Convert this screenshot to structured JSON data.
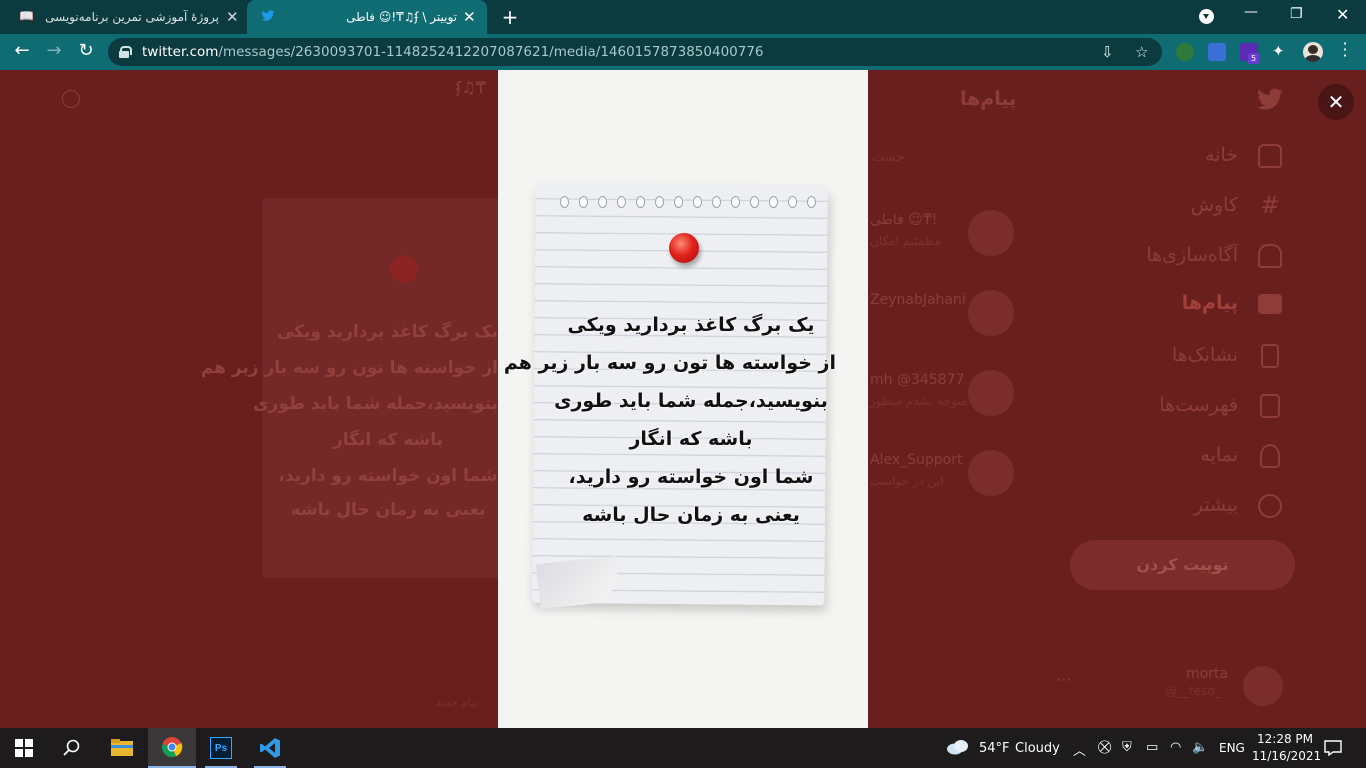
{
  "browser": {
    "tabs": [
      {
        "title": "پروژهٔ آموزشی تمرین برنامه‌نویسی: ‌ه",
        "favicon": "book-icon"
      },
      {
        "title": "توییتر \\ ʄ♫₸!☺ فاطی",
        "favicon": "twitter-icon"
      }
    ],
    "url_host": "twitter.com",
    "url_path": "/messages/2630093701-1148252412207087621/media/1460157873850400776"
  },
  "twitter": {
    "nav": [
      {
        "label": "خانه",
        "icon": "home-icon"
      },
      {
        "label": "کاوش",
        "icon": "hashtag-icon"
      },
      {
        "label": "آگاه‌سازی‌ها",
        "icon": "bell-icon"
      },
      {
        "label": "پیام‌ها",
        "icon": "mail-icon",
        "active": true
      },
      {
        "label": "نشانک‌ها",
        "icon": "bookmark-icon"
      },
      {
        "label": "فهرست‌ها",
        "icon": "list-icon"
      },
      {
        "label": "نمایه",
        "icon": "person-icon"
      },
      {
        "label": "بیشتر",
        "icon": "more-icon"
      }
    ],
    "tweet_button": "توییت کردن",
    "messages_title": "پیام‌ها",
    "search_placeholder": "جست",
    "conversations": [
      {
        "name": "فاطی ☺₸!",
        "sub": "مطمئنم امکان"
      },
      {
        "name": "ZeynabJahani",
        "sub": ""
      },
      {
        "name": "mh @345877",
        "sub": "متوجه نشدم منظور"
      },
      {
        "name": "Alex_Support",
        "sub": "این در خواست"
      }
    ],
    "header_title": "ʄ♫₸",
    "user_name": "morta",
    "user_handle": "@__teso_",
    "new_message_hint": "پیام جدید"
  },
  "media": {
    "poem_lines": [
      "یک برگ کاغذ بردارید ویکی",
      "از خواسته ها تون رو سه بار زیر هم",
      "بنویسید،جمله شما باید طوری",
      "باشه که انگار",
      "شما اون خواسته رو دارید،",
      "یعنی به زمان حال باشه"
    ]
  },
  "taskbar": {
    "weather_temp": "54°F",
    "weather_text": "Cloudy",
    "language": "ENG",
    "time": "12:28 PM",
    "date": "11/16/2021",
    "apps": [
      "start-icon",
      "search-icon",
      "file-explorer-icon",
      "chrome-icon",
      "photoshop-icon",
      "vscode-icon"
    ]
  }
}
